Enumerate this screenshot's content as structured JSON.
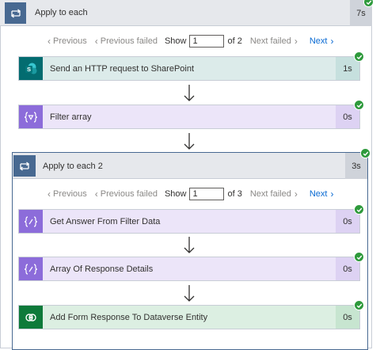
{
  "outer_loop": {
    "title": "Apply to each",
    "duration": "7s",
    "pager": {
      "previous": "Previous",
      "previous_failed": "Previous failed",
      "show": "Show",
      "current": "1",
      "of_total": "of 2",
      "next_failed": "Next failed",
      "next": "Next"
    },
    "actions": [
      {
        "label": "Send an HTTP request to SharePoint",
        "duration": "1s",
        "icon": "sharepoint-icon"
      },
      {
        "label": "Filter array",
        "duration": "0s",
        "icon": "data-operation-icon"
      }
    ]
  },
  "inner_loop": {
    "title": "Apply to each 2",
    "duration": "3s",
    "pager": {
      "previous": "Previous",
      "previous_failed": "Previous failed",
      "show": "Show",
      "current": "1",
      "of_total": "of 3",
      "next_failed": "Next failed",
      "next": "Next"
    },
    "actions": [
      {
        "label": "Get Answer From Filter Data",
        "duration": "0s",
        "icon": "data-operation-icon"
      },
      {
        "label": "Array Of Response Details",
        "duration": "0s",
        "icon": "data-operation-icon"
      },
      {
        "label": "Add Form Response To Dataverse Entity",
        "duration": "0s",
        "icon": "dataverse-icon"
      }
    ]
  },
  "colors": {
    "loop_header": "#486991",
    "sharepoint": "#036c70",
    "data_operation": "#8c6cda",
    "dataverse": "#0e7a3a",
    "success": "#2e9a3c",
    "link": "#0b6bd3"
  }
}
